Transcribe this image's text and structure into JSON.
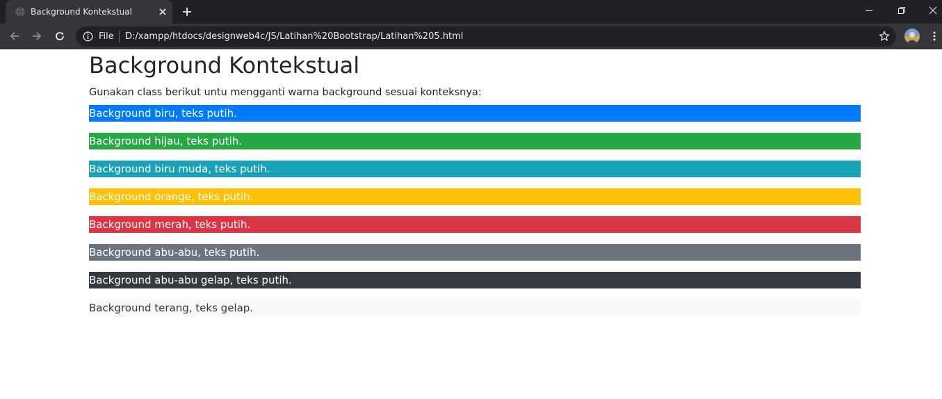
{
  "browser": {
    "tab_title": "Background Kontekstual",
    "scheme_label": "File",
    "url": "D:/xampp/htdocs/designweb4c/JS/Latihan%20Bootstrap/Latihan%205.html"
  },
  "page": {
    "title": "Background Kontekstual",
    "lead": "Gunakan class berikut untu mengganti warna background sesuai konteksnya:",
    "bars": [
      {
        "label": "Background biru, teks putih.",
        "color": "#007bff",
        "text_color": "#ffffff"
      },
      {
        "label": "Background hijau, teks putih.",
        "color": "#28a745",
        "text_color": "#ffffff"
      },
      {
        "label": "Background biru muda, teks putih.",
        "color": "#17a2b8",
        "text_color": "#ffffff"
      },
      {
        "label": "Background orange, teks putih.",
        "color": "#ffc107",
        "text_color": "#ffffff"
      },
      {
        "label": "Background merah, teks putih.",
        "color": "#dc3545",
        "text_color": "#ffffff"
      },
      {
        "label": "Background abu-abu, teks putih.",
        "color": "#6c757d",
        "text_color": "#ffffff"
      },
      {
        "label": "Background abu-abu gelap, teks putih.",
        "color": "#343a40",
        "text_color": "#ffffff"
      },
      {
        "label": "Background terang, teks gelap.",
        "color": "#f8f9fa",
        "text_color": "#343a40"
      }
    ]
  }
}
